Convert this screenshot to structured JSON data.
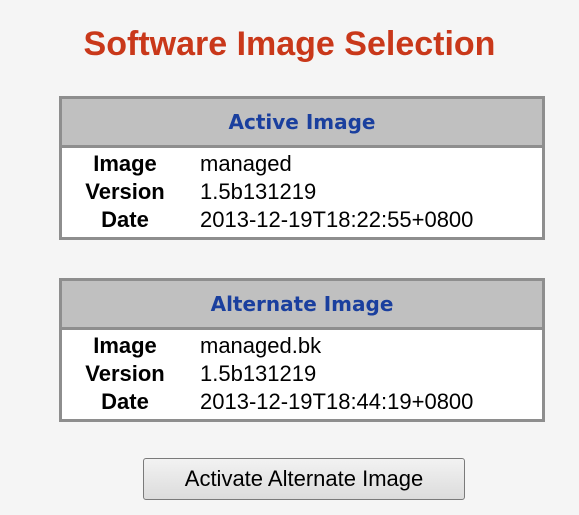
{
  "page": {
    "title": "Software Image Selection"
  },
  "active_image": {
    "header": "Active Image",
    "rows": [
      {
        "label": "Image",
        "value": "managed"
      },
      {
        "label": "Version",
        "value": "1.5b131219"
      },
      {
        "label": "Date",
        "value": "2013-12-19T18:22:55+0800"
      }
    ]
  },
  "alternate_image": {
    "header": "Alternate Image",
    "rows": [
      {
        "label": "Image",
        "value": "managed.bk"
      },
      {
        "label": "Version",
        "value": "1.5b131219"
      },
      {
        "label": "Date",
        "value": "2013-12-19T18:44:19+0800"
      }
    ]
  },
  "actions": {
    "activate_label": "Activate Alternate Image"
  },
  "colors": {
    "title": "#c9381a",
    "table_header_text": "#1a3f9e",
    "table_header_bg": "#c0c0c0",
    "table_border": "#8e8e8e",
    "page_bg": "#f5f5f5"
  }
}
